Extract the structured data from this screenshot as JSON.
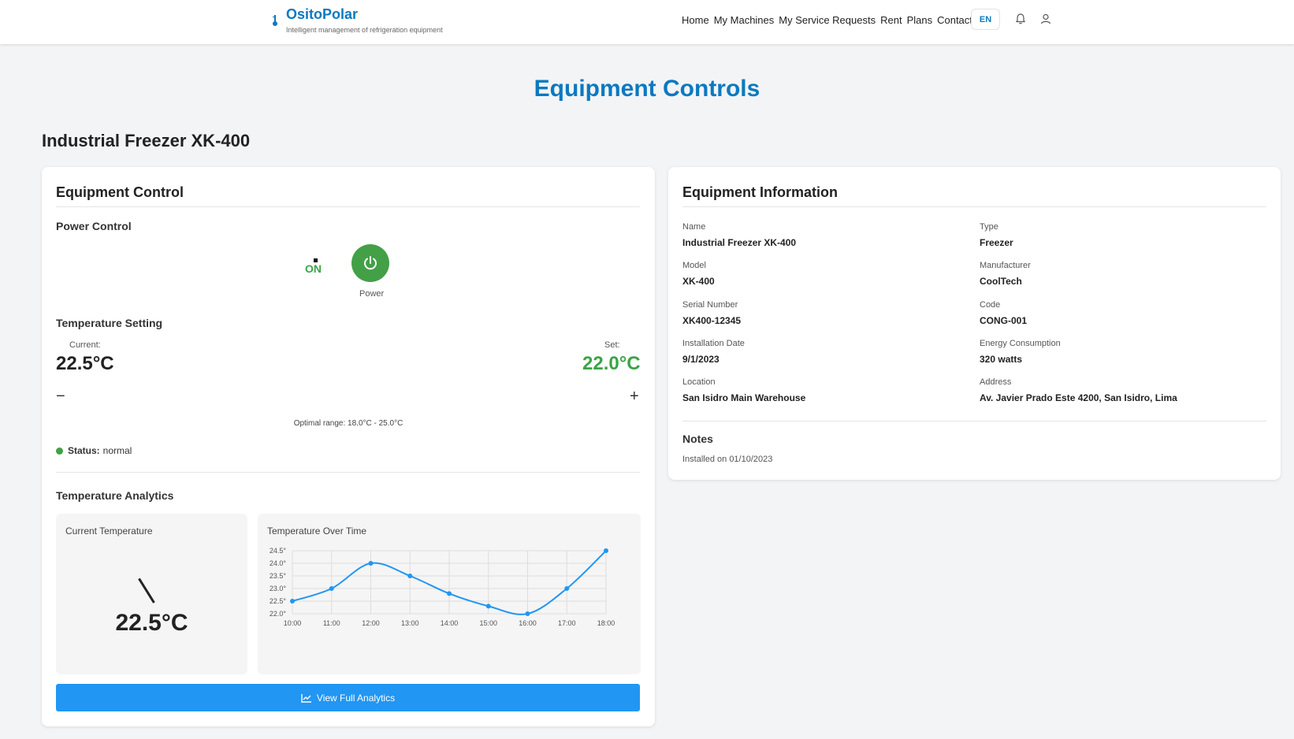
{
  "header": {
    "brand_name": "OsitoPolar",
    "brand_tagline": "Intelligent management of refrigeration equipment",
    "nav": [
      "Home",
      "My Machines",
      "My Service Requests",
      "Rent",
      "Plans",
      "Contact"
    ],
    "language": "EN"
  },
  "page_title": "Equipment Controls",
  "machine_title": "Industrial Freezer XK-400",
  "control": {
    "title": "Equipment Control",
    "power_heading": "Power Control",
    "power_state": "ON",
    "power_label": "Power",
    "temp_heading": "Temperature Setting",
    "current_caption": "Current:",
    "current_value": "22.5°C",
    "set_caption": "Set:",
    "set_value": "22.0°C",
    "decrease_label": "−",
    "increase_label": "+",
    "optimal_range": "Optimal range: 18.0°C - 25.0°C",
    "status_label": "Status:",
    "status_value": "normal",
    "analytics_heading": "Temperature Analytics",
    "gauge_title": "Current Temperature",
    "gauge_value": "22.5°C",
    "chart_title": "Temperature Over Time",
    "view_button": "View Full Analytics"
  },
  "chart_data": {
    "type": "line",
    "title": "Temperature Over Time",
    "categories": [
      "10:00",
      "11:00",
      "12:00",
      "13:00",
      "14:00",
      "15:00",
      "16:00",
      "17:00",
      "18:00"
    ],
    "series": [
      {
        "values": [
          22.5,
          23.0,
          24.0,
          23.5,
          22.8,
          22.3,
          22.0,
          23.0,
          24.5
        ]
      }
    ],
    "yticks": [
      "22.0°",
      "22.5°",
      "23.0°",
      "23.5°",
      "24.0°",
      "24.5°"
    ],
    "ylim": [
      22.0,
      24.5
    ],
    "grid": true,
    "color": "#2196f3"
  },
  "info": {
    "title": "Equipment Information",
    "fields": [
      {
        "label": "Name",
        "value": "Industrial Freezer XK-400"
      },
      {
        "label": "Type",
        "value": "Freezer"
      },
      {
        "label": "Model",
        "value": "XK-400"
      },
      {
        "label": "Manufacturer",
        "value": "CoolTech"
      },
      {
        "label": "Serial Number",
        "value": "XK400-12345"
      },
      {
        "label": "Code",
        "value": "CONG-001"
      },
      {
        "label": "Installation Date",
        "value": "9/1/2023"
      },
      {
        "label": "Energy Consumption",
        "value": "320 watts"
      },
      {
        "label": "Location",
        "value": "San Isidro Main Warehouse"
      },
      {
        "label": "Address",
        "value": "Av. Javier Prado Este 4200, San Isidro, Lima"
      }
    ],
    "notes_heading": "Notes",
    "notes_value": "Installed on 01/10/2023"
  },
  "colors": {
    "brand": "#0b79c0",
    "success": "#43a047",
    "accent": "#2196f3"
  }
}
